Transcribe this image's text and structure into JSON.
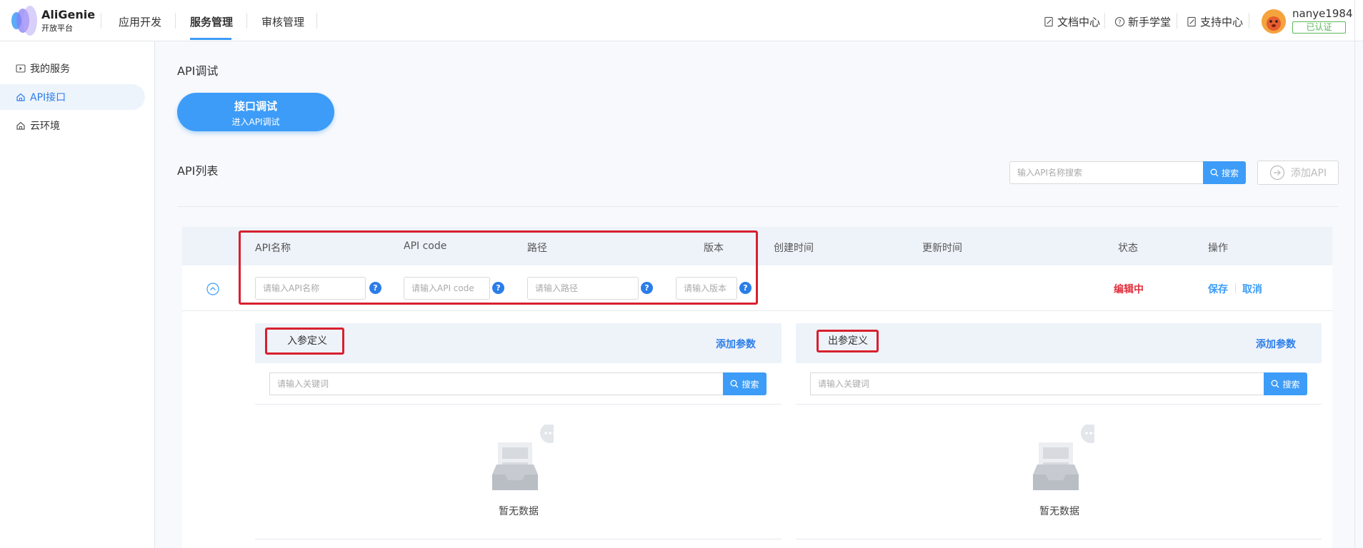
{
  "brand": {
    "name": "AliGenie",
    "sub": "开放平台"
  },
  "nav": {
    "items": [
      "应用开发",
      "服务管理",
      "审核管理"
    ],
    "active": "服务管理"
  },
  "top_links": {
    "docs": "文档中心",
    "learn": "新手学堂",
    "support": "支持中心"
  },
  "user": {
    "name": "nanye1984",
    "badge": "已认证"
  },
  "sidebar": {
    "items": [
      {
        "label": "我的服务",
        "icon": "play-square-icon"
      },
      {
        "label": "API接口",
        "icon": "home-icon",
        "active": true
      },
      {
        "label": "云环境",
        "icon": "home-icon"
      }
    ]
  },
  "main": {
    "debug_title": "API调试",
    "debug_button": {
      "line1": "接口调试",
      "line2": "进入API调试"
    },
    "list_title": "API列表",
    "search_placeholder": "输入API名称搜索",
    "search_label": "搜索",
    "add_api_label": "添加API"
  },
  "table": {
    "columns": [
      "API名称",
      "API code",
      "路径",
      "版本",
      "创建时间",
      "更新时间",
      "状态",
      "操作"
    ],
    "row": {
      "placeholders": {
        "name": "请输入API名称",
        "code": "请输入API code",
        "path": "请输入路径",
        "version": "请输入版本"
      },
      "help_glyph": "?",
      "status": "编辑中",
      "save": "保存",
      "cancel": "取消"
    }
  },
  "params": {
    "input_title": "入参定义",
    "output_title": "出参定义",
    "add_param": "添加参数",
    "keyword_placeholder": "请输入关键词",
    "search_label": "搜索",
    "empty": "暂无数据"
  },
  "colors": {
    "accent": "#3d9cf7",
    "status_editing": "#e0303e",
    "verified": "#5bb85b",
    "annotation": "#d8202e"
  }
}
